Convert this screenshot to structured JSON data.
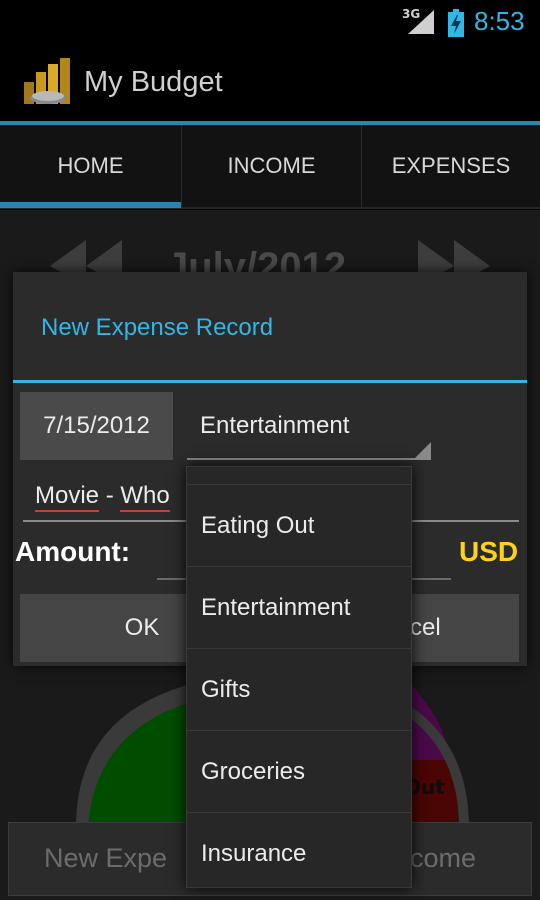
{
  "status_bar": {
    "network": "3G",
    "time": "8:53"
  },
  "app": {
    "title": "My Budget"
  },
  "tabs": [
    {
      "label": "HOME"
    },
    {
      "label": "INCOME"
    },
    {
      "label": "EXPENSES"
    }
  ],
  "background": {
    "month": "July/2012",
    "pie_label": "Out",
    "left_button": "New Expe",
    "right_button": "come"
  },
  "dialog": {
    "title": "New Expense Record",
    "date": "7/15/2012",
    "category": "Entertainment",
    "description_word1": "Movie",
    "description_sep": " - ",
    "description_word2": "Who",
    "amount_label": "Amount:",
    "currency": "USD",
    "ok_label": "OK",
    "cancel_label": "cel"
  },
  "dropdown": {
    "options": [
      "Eating Out",
      "Entertainment",
      "Gifts",
      "Groceries",
      "Insurance"
    ]
  },
  "colors": {
    "accent": "#33b5e5",
    "currency": "#ffd21a",
    "pie_green": "#008a00",
    "pie_purple": "#7a0a7a",
    "pie_red": "#7a0a0a"
  }
}
